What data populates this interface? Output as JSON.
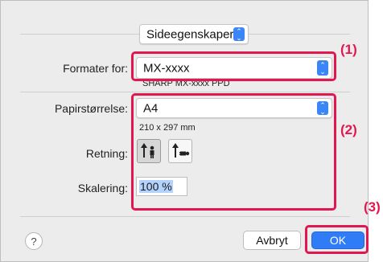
{
  "dialog": {
    "page_attributes_popup": "Sideegenskaper",
    "format_for_label": "Formater for:",
    "format_for_value": "MX-xxxx",
    "printer_ppd": "SHARP MX-xxxx PPD",
    "paper_size_label": "Papirstørrelse:",
    "paper_size_value": "A4",
    "paper_dimensions": "210 x 297 mm",
    "orientation_label": "Retning:",
    "orientation_options": [
      "portrait-icon",
      "landscape-icon"
    ],
    "orientation_selected": "portrait",
    "scale_label": "Skalering:",
    "scale_value": "100 %",
    "help_label": "?",
    "cancel_label": "Avbryt",
    "ok_label": "OK"
  },
  "callouts": {
    "c1": "(1)",
    "c2": "(2)",
    "c3": "(3)"
  },
  "colors": {
    "callout": "#e3174f",
    "accent": "#3a86f7",
    "dialog_bg": "#ececec"
  }
}
